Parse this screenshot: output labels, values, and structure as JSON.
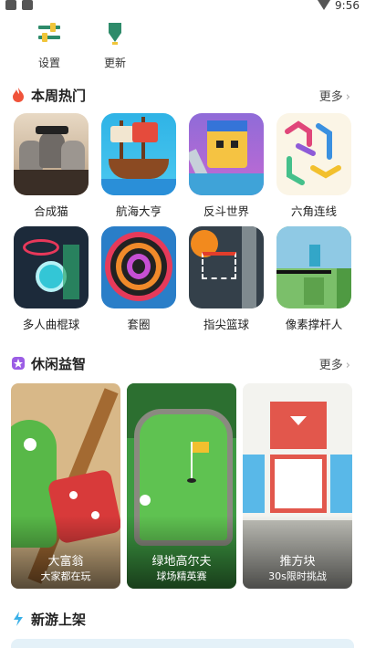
{
  "status_bar": {
    "time": "9:56"
  },
  "top_buttons": [
    {
      "label": "设置",
      "icon": "settings-icon"
    },
    {
      "label": "更新",
      "icon": "update-icon"
    }
  ],
  "sections": {
    "hot": {
      "title": "本周热门",
      "more": "更多",
      "icon": "flame-icon"
    },
    "casual": {
      "title": "休闲益智",
      "more": "更多",
      "icon": "star-icon"
    },
    "new": {
      "title": "新游上架",
      "icon": "lightning-icon"
    }
  },
  "hot_games": [
    {
      "name": "合成猫"
    },
    {
      "name": "航海大亨"
    },
    {
      "name": "反斗世界"
    },
    {
      "name": "六角连线"
    },
    {
      "name": "多人曲棍球"
    },
    {
      "name": "套圈"
    },
    {
      "name": "指尖篮球"
    },
    {
      "name": "像素撑杆人"
    }
  ],
  "casual_cards": [
    {
      "title": "大富翁",
      "subtitle": "大家都在玩"
    },
    {
      "title": "绿地高尔夫",
      "subtitle": "球场精英赛"
    },
    {
      "title": "推方块",
      "subtitle": "30s限时挑战"
    }
  ],
  "colors": {
    "accent_green": "#2e9e6e",
    "flame": "#f0533a",
    "star": "#9b5de5",
    "lightning": "#3ab0e8"
  }
}
